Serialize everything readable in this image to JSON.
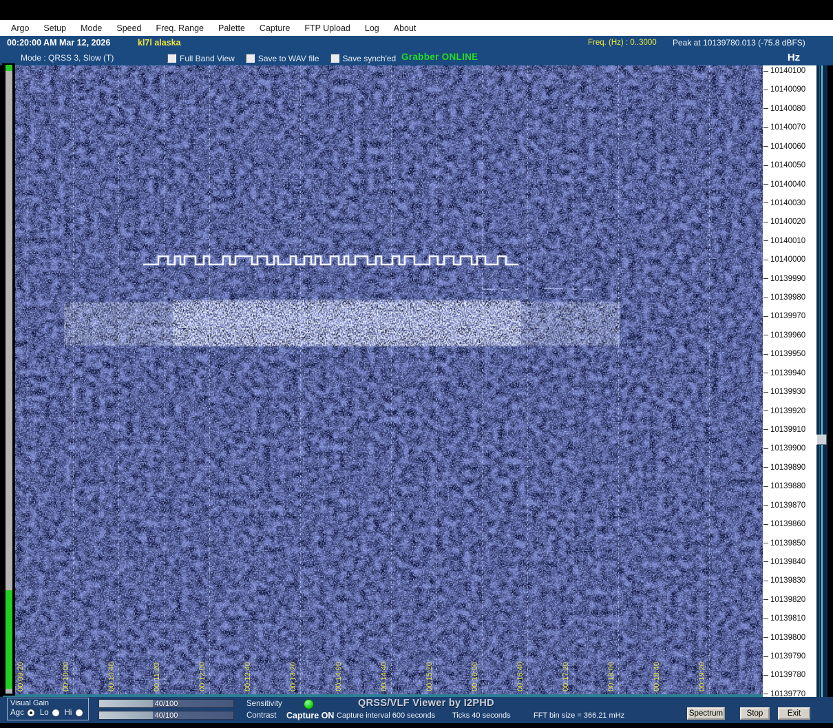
{
  "colors": {
    "titlebar_blue": "#1a4a80",
    "bottombar_blue": "#1c4170",
    "waterfall_navy": "#0b123e",
    "accent_yellow": "#f2e63c",
    "status_green": "#22dd22",
    "scale_bg": "#ffffff",
    "cyan_slider_line": "#49cdd8",
    "gauge_green": "#23ce23"
  },
  "menu": {
    "items": [
      "Argo",
      "Setup",
      "Mode",
      "Speed",
      "Freq. Range",
      "Palette",
      "Capture",
      "FTP Upload",
      "Log",
      "About"
    ]
  },
  "titlebar": {
    "datetime": "00:20:00 AM  Mar 12, 2026",
    "callsign": "kl7l alaska",
    "freq_range_label": "Freq. (Hz) :   0..3000",
    "peak_label": "Peak at 10139780.013 (-75.8 dBFS)"
  },
  "statusrow": {
    "mode_label": "Mode : QRSS 3, Slow  (T)",
    "checkboxes": [
      {
        "label": "Full Band View",
        "checked": false
      },
      {
        "label": "Save to WAV file",
        "checked": false
      },
      {
        "label": "Save synch'ed",
        "checked": false
      }
    ],
    "grabber_status": "Grabber ONLINE",
    "scale_unit": "Hz"
  },
  "freq_scale": {
    "values": [
      "10140100",
      "10140090",
      "10140080",
      "10140070",
      "10140060",
      "10140050",
      "10140040",
      "10140030",
      "10140020",
      "10140010",
      "10140000",
      "10139990",
      "10139980",
      "10139970",
      "10139960",
      "10139950",
      "10139940",
      "10139930",
      "10139920",
      "10139910",
      "10139900",
      "10139890",
      "10139880",
      "10139870",
      "10139860",
      "10139850",
      "10139840",
      "10139830",
      "10139820",
      "10139810",
      "10139800",
      "10139790",
      "10139780",
      "10139770"
    ]
  },
  "waterfall": {
    "time_ticks": [
      "00:09:20",
      "00:10:00",
      "00:10:40",
      "00:11:20",
      "00:12:00",
      "00:12:40",
      "00:13:20",
      "00:14:00",
      "00:14:40",
      "00:15:20",
      "00:16:00",
      "00:16:40",
      "00:17:20",
      "00:18:00",
      "00:18:40",
      "00:19:20"
    ],
    "signal": {
      "segments": [
        [
          22,
          1
        ],
        [
          14,
          0
        ],
        [
          10,
          1
        ],
        [
          8,
          0
        ],
        [
          6,
          1
        ],
        [
          16,
          0
        ],
        [
          12,
          1
        ],
        [
          8,
          0
        ],
        [
          20,
          1
        ],
        [
          10,
          0
        ],
        [
          8,
          1
        ],
        [
          24,
          0
        ],
        [
          8,
          1
        ],
        [
          14,
          0
        ],
        [
          10,
          1
        ],
        [
          6,
          0
        ],
        [
          18,
          1
        ],
        [
          8,
          0
        ],
        [
          12,
          1
        ],
        [
          10,
          0
        ],
        [
          6,
          1
        ],
        [
          8,
          0
        ],
        [
          14,
          1
        ],
        [
          12,
          0
        ],
        [
          8,
          1
        ],
        [
          6,
          0
        ],
        [
          10,
          1
        ],
        [
          18,
          0
        ],
        [
          12,
          1
        ],
        [
          8,
          0
        ],
        [
          16,
          1
        ],
        [
          10,
          0
        ],
        [
          8,
          1
        ],
        [
          14,
          0
        ],
        [
          22,
          1
        ],
        [
          12,
          0
        ],
        [
          9,
          1
        ],
        [
          14,
          0
        ],
        [
          10,
          1
        ],
        [
          16,
          0
        ],
        [
          8,
          1
        ],
        [
          12,
          0
        ],
        [
          18,
          1
        ],
        [
          12,
          0
        ],
        [
          18,
          1
        ]
      ]
    }
  },
  "bottom": {
    "visual_gain": {
      "title": "Visual Gain",
      "options": [
        {
          "label": "Agc",
          "selected": true
        },
        {
          "label": "Lo",
          "selected": false
        },
        {
          "label": "Hi",
          "selected": false
        }
      ]
    },
    "sliders": [
      {
        "value": "40/100",
        "label": "Sensitivity"
      },
      {
        "value": "40/100",
        "label": "Contrast"
      }
    ],
    "capture_led": "on",
    "capture_state": "Capture ON",
    "app_title": "QRSS/VLF Viewer by I2PHD",
    "capture_interval": "Capture interval 600 seconds",
    "ticks_info": "Ticks  40 seconds",
    "fft_info": "FFT bin size = 366.21 mHz",
    "buttons": [
      "Spectrum",
      "Stop",
      "Exit"
    ]
  }
}
